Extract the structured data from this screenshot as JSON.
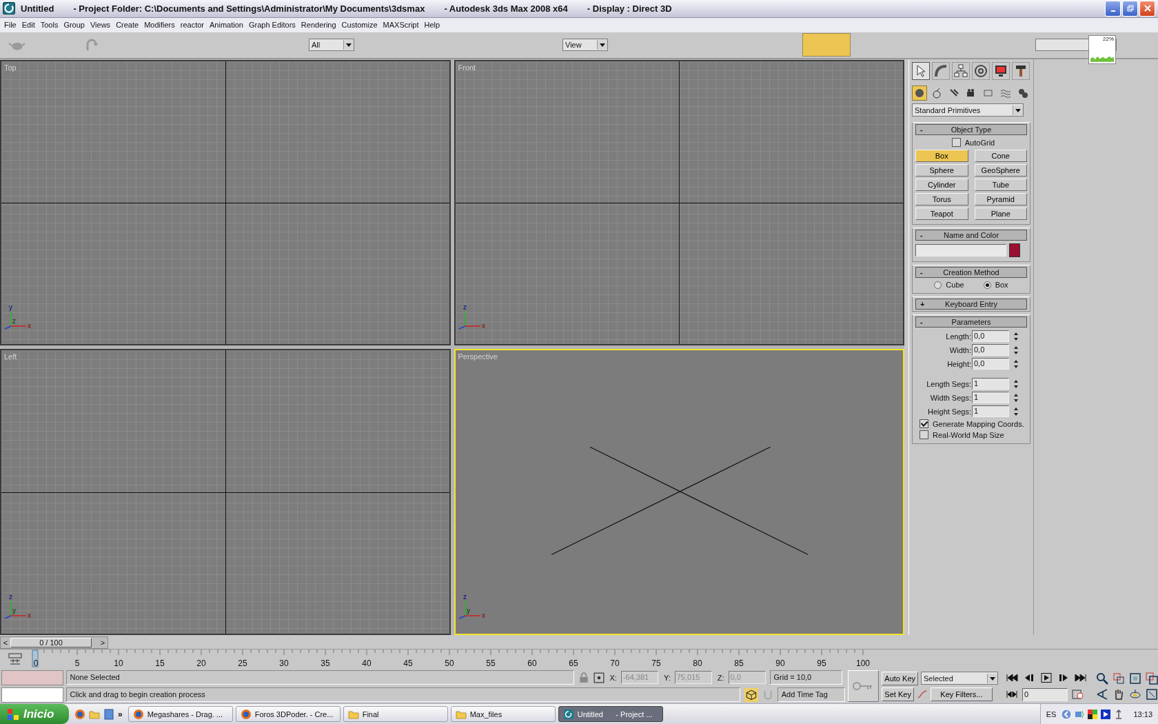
{
  "window": {
    "title_parts": [
      "Untitled",
      "- Project Folder: C:\\Documents and Settings\\Administrator\\My Documents\\3dsmax",
      "- Autodesk 3ds Max 2008 x64",
      "- Display : Direct 3D"
    ]
  },
  "menu": [
    "File",
    "Edit",
    "Tools",
    "Group",
    "Views",
    "Create",
    "Modifiers",
    "reactor",
    "Animation",
    "Graph Editors",
    "Rendering",
    "Customize",
    "MAXScript",
    "Help"
  ],
  "toolbar": {
    "selection_filter": "All",
    "reference_coord": "View",
    "cpu_meter": "22%"
  },
  "viewports": [
    {
      "label": "Top",
      "kind": "grid",
      "active": false,
      "axes": [
        "y",
        "x",
        "z"
      ]
    },
    {
      "label": "Front",
      "kind": "grid",
      "active": false,
      "axes": [
        "z",
        "x"
      ]
    },
    {
      "label": "Left",
      "kind": "grid",
      "active": false,
      "axes": [
        "z",
        "x",
        "y"
      ]
    },
    {
      "label": "Perspective",
      "kind": "perspective",
      "active": true,
      "axes": [
        "z",
        "x",
        "y"
      ]
    }
  ],
  "command_panel": {
    "tabs": [
      {
        "kind": "create",
        "selected": true
      },
      {
        "kind": "modify",
        "selected": false
      },
      {
        "kind": "hierarchy",
        "selected": false
      },
      {
        "kind": "motion",
        "selected": false
      },
      {
        "kind": "display",
        "selected": false
      },
      {
        "kind": "utilities",
        "selected": false
      }
    ],
    "categories": [
      {
        "kind": "geometry",
        "selected": true
      },
      {
        "kind": "shapes",
        "selected": false
      },
      {
        "kind": "lights",
        "selected": false
      },
      {
        "kind": "cameras",
        "selected": false
      },
      {
        "kind": "helpers",
        "selected": false
      },
      {
        "kind": "spacewarps",
        "selected": false
      },
      {
        "kind": "systems",
        "selected": false
      }
    ],
    "dropdown": "Standard Primitives",
    "object_type": {
      "toggle": "-",
      "title": "Object Type",
      "autogrid": {
        "label": "AutoGrid",
        "checked": false
      },
      "buttons": [
        {
          "label": "Box",
          "selected": true
        },
        {
          "label": "Cone",
          "selected": false
        },
        {
          "label": "Sphere",
          "selected": false
        },
        {
          "label": "GeoSphere",
          "selected": false
        },
        {
          "label": "Cylinder",
          "selected": false
        },
        {
          "label": "Tube",
          "selected": false
        },
        {
          "label": "Torus",
          "selected": false
        },
        {
          "label": "Pyramid",
          "selected": false
        },
        {
          "label": "Teapot",
          "selected": false
        },
        {
          "label": "Plane",
          "selected": false
        }
      ]
    },
    "name_and_color": {
      "toggle": "-",
      "title": "Name and Color",
      "color": "#9b1030"
    },
    "creation_method": {
      "toggle": "-",
      "title": "Creation Method",
      "options": [
        {
          "label": "Cube",
          "selected": false
        },
        {
          "label": "Box",
          "selected": true
        }
      ]
    },
    "keyboard_entry": {
      "toggle": "+",
      "title": "Keyboard Entry"
    },
    "parameters": {
      "toggle": "-",
      "title": "Parameters",
      "fields": [
        {
          "label": "Length:",
          "value": "0,0"
        },
        {
          "label": "Width:",
          "value": "0,0"
        },
        {
          "label": "Height:",
          "value": "0,0"
        }
      ],
      "segs": [
        {
          "label": "Length Segs:",
          "value": "1"
        },
        {
          "label": "Width Segs:",
          "value": "1"
        },
        {
          "label": "Height Segs:",
          "value": "1"
        }
      ],
      "checks": [
        {
          "label": "Generate Mapping Coords.",
          "checked": true
        },
        {
          "label": "Real-World Map Size",
          "checked": false
        }
      ]
    }
  },
  "time_slider": {
    "prev": "<",
    "next": ">",
    "position": "0 / 100"
  },
  "ruler": [
    "0",
    "5",
    "10",
    "15",
    "20",
    "25",
    "30",
    "35",
    "40",
    "45",
    "50",
    "55",
    "60",
    "65",
    "70",
    "75",
    "80",
    "85",
    "90",
    "95",
    "100"
  ],
  "status": {
    "selection": "None Selected",
    "prompt": "Click and drag to begin creation process",
    "coords": [
      {
        "label": "X:",
        "value": "-64,381"
      },
      {
        "label": "Y:",
        "value": "75,015"
      },
      {
        "label": "Z:",
        "value": "0,0"
      }
    ],
    "grid": "Grid = 10,0",
    "time_tag": "Add Time Tag",
    "auto_key": "Auto Key",
    "set_key": "Set Key",
    "key_mode": "Selected",
    "key_filters": "Key Filters...",
    "frame": "0"
  },
  "taskbar": {
    "start": "Inicio",
    "quick_more": "»",
    "tasks": [
      {
        "label": "Megashares - Drag. ...",
        "kind": "browser",
        "selected": false
      },
      {
        "label": "Foros 3DPoder. - Cre...",
        "kind": "browser",
        "selected": false
      },
      {
        "label": "Final",
        "kind": "folder",
        "selected": false
      },
      {
        "label": "Max_files",
        "kind": "folder",
        "selected": false
      },
      {
        "label": "Untitled      - Project ...",
        "kind": "max",
        "selected": true
      }
    ],
    "language": "ES",
    "clock": "13:13"
  }
}
